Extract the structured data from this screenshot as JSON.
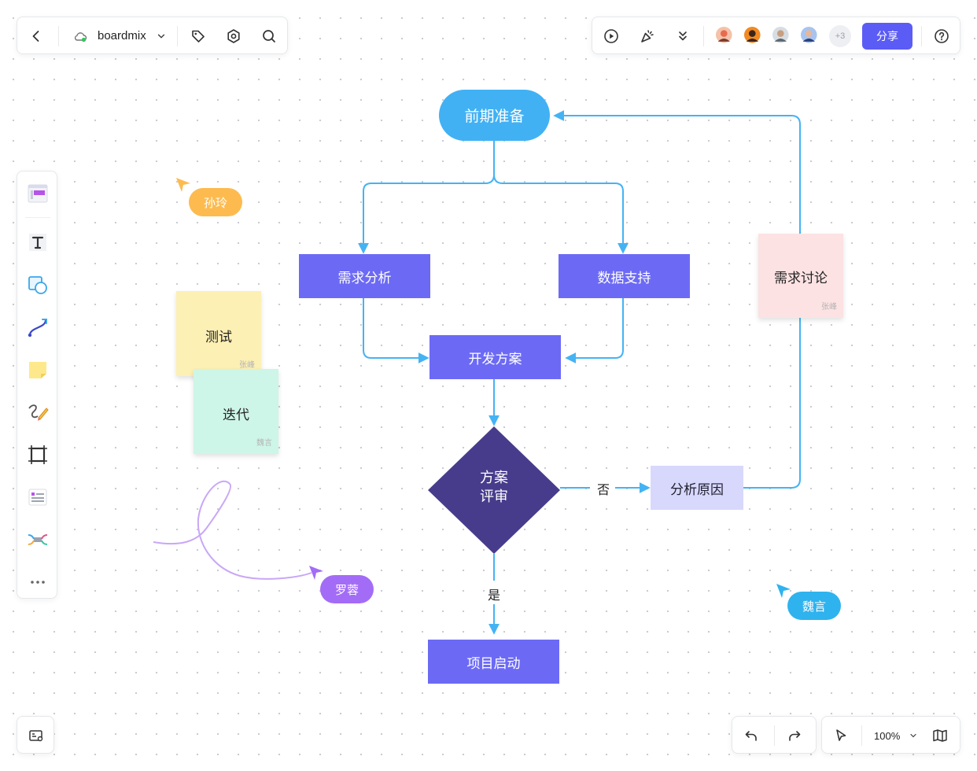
{
  "app": {
    "board_name": "boardmix"
  },
  "header": {
    "share_label": "分享",
    "more_collaborators": "+3",
    "avatars": [
      {
        "name": "avatar-1",
        "color": "#e86a4f"
      },
      {
        "name": "avatar-2",
        "color": "#f08a24"
      },
      {
        "name": "avatar-3",
        "color": "#b9c3cc"
      },
      {
        "name": "avatar-4",
        "color": "#5c7bd6"
      }
    ]
  },
  "flowchart": {
    "start": "前期准备",
    "requirements": "需求分析",
    "data_support": "数据支持",
    "dev_plan": "开发方案",
    "review_line1": "方案",
    "review_line2": "评审",
    "no_label": "否",
    "yes_label": "是",
    "analyze_reason": "分析原因",
    "launch": "项目启动"
  },
  "stickies": {
    "test": {
      "text": "测试",
      "author": "张峰"
    },
    "iterate": {
      "text": "迭代",
      "author": "魏言"
    },
    "discuss": {
      "text": "需求讨论",
      "author": "张峰"
    }
  },
  "cursors": {
    "sunling": {
      "name": "孙玲",
      "color": "#fdbb4f"
    },
    "luorong": {
      "name": "罗蓉",
      "color": "#a36cf6"
    },
    "weiyan": {
      "name": "魏言",
      "color": "#2fb3ee"
    }
  },
  "footer": {
    "zoom": "100%"
  },
  "colors": {
    "accent": "#5b5cf6",
    "edge": "#45b3f3",
    "node_primary": "#6c6af5",
    "node_start": "#41b1f4",
    "decision": "#473c8c"
  }
}
